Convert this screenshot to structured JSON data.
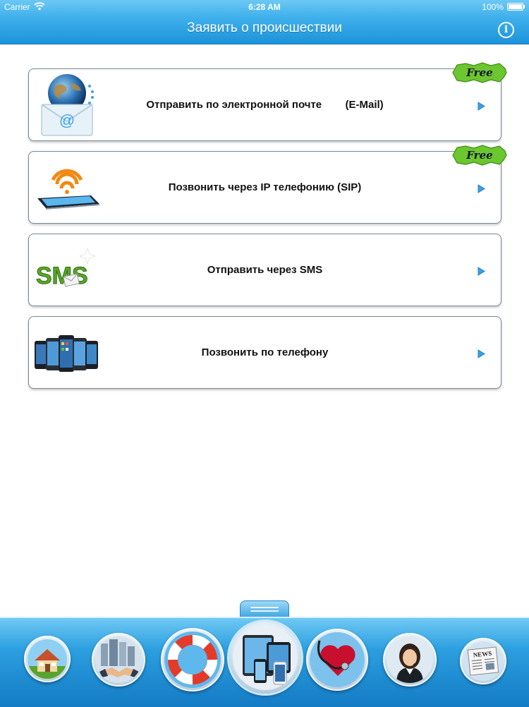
{
  "status_bar": {
    "carrier": "Carrier",
    "time": "6:28 AM",
    "battery": "100%"
  },
  "nav": {
    "title": "Заявить о происшествии",
    "info_icon": "info-icon"
  },
  "colors": {
    "nav_blue": "#1c93d9",
    "chevron_blue": "#3aa0e6",
    "free_green": "#6cc62f",
    "text": "#111111"
  },
  "menu": {
    "items": [
      {
        "label": "Отправить по электронной почте        (E-Mail)",
        "icon": "email-globe-icon",
        "badge": "Free"
      },
      {
        "label": "Позвонить через IP телефонию (SIP)",
        "icon": "wifi-tablet-icon",
        "badge": "Free"
      },
      {
        "label": "Отправить через SMS",
        "icon": "sms-icon"
      },
      {
        "label": "Позвонить по телефону",
        "icon": "phones-icon"
      }
    ]
  },
  "tabbar": {
    "tabs": [
      {
        "icon": "house-icon",
        "selected": false
      },
      {
        "icon": "handshake-icon",
        "selected": false
      },
      {
        "icon": "lifebuoy-icon",
        "selected": false
      },
      {
        "icon": "devices-icon",
        "selected": true
      },
      {
        "icon": "stethoscope-heart-icon",
        "selected": false
      },
      {
        "icon": "operator-icon",
        "selected": false
      },
      {
        "icon": "newspaper-icon",
        "selected": false,
        "news_text": "NEWS"
      }
    ]
  }
}
